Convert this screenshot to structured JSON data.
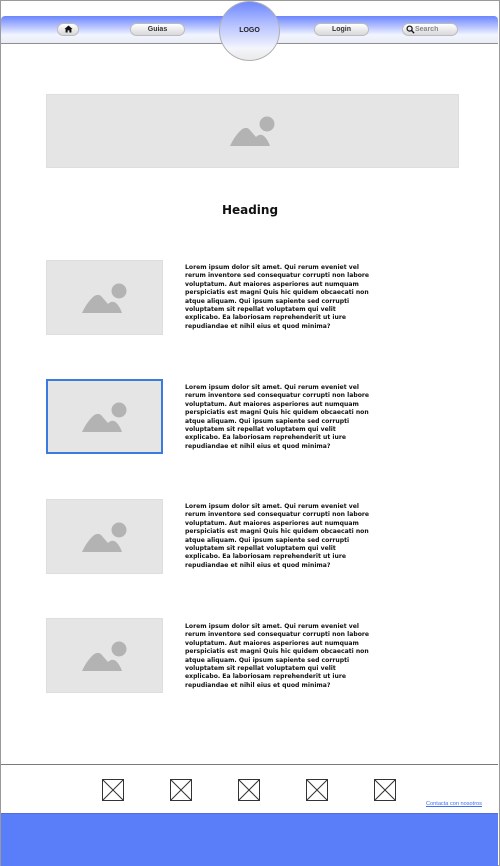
{
  "nav": {
    "home_icon": "home-icon",
    "guias_label": "Guias",
    "logo_label": "LOGO",
    "login_label": "Login",
    "search_placeholder": "Search",
    "search_icon": "search-icon",
    "accent_color": "#6b86ff"
  },
  "main": {
    "heading": "Heading",
    "image_icon": "image-placeholder-icon",
    "sections": [
      {
        "text": "Lorem ipsum dolor sit amet. Qui rerum eveniet vel rerum inventore sed consequatur corrupti non labore voluptatum. Aut maiores asperiores aut numquam perspiciatis est magni Quis hic quidem obcaecati non atque aliquam. Qui ipsum sapiente sed corrupti voluptatem sit repellat voluptatem qui velit explicabo. Ea laboriosam reprehenderit ut iure repudiandae et nihil eius et quod minima?",
        "selected": false
      },
      {
        "text": "Lorem ipsum dolor sit amet. Qui rerum eveniet vel rerum inventore sed consequatur corrupti non labore voluptatum. Aut maiores asperiores aut numquam perspiciatis est magni Quis hic quidem obcaecati non atque aliquam. Qui ipsum sapiente sed corrupti voluptatem sit repellat voluptatem qui velit explicabo. Ea laboriosam reprehenderit ut iure repudiandae et nihil eius et quod minima?",
        "selected": true
      },
      {
        "text": "Lorem ipsum dolor sit amet. Qui rerum eveniet vel rerum inventore sed consequatur corrupti non labore voluptatum. Aut maiores asperiores aut numquam perspiciatis est magni Quis hic quidem obcaecati non atque aliquam. Qui ipsum sapiente sed corrupti voluptatem sit repellat voluptatem qui velit explicabo. Ea laboriosam reprehenderit ut iure repudiandae et nihil eius et quod minima?",
        "selected": false
      },
      {
        "text": "Lorem ipsum dolor sit amet. Qui rerum eveniet vel rerum inventore sed consequatur corrupti non labore voluptatum. Aut maiores asperiores aut numquam perspiciatis est magni Quis hic quidem obcaecati non atque aliquam. Qui ipsum sapiente sed corrupti voluptatem sit repellat voluptatem qui velit explicabo. Ea laboriosam reprehenderit ut iure repudiandae et nihil eius et quod minima?",
        "selected": false
      }
    ]
  },
  "footer": {
    "social_placeholder_icon": "placeholder-x-icon",
    "social_count": 5,
    "contact_link": "Contacta con nosotros",
    "bar_color": "#5a7df9"
  }
}
